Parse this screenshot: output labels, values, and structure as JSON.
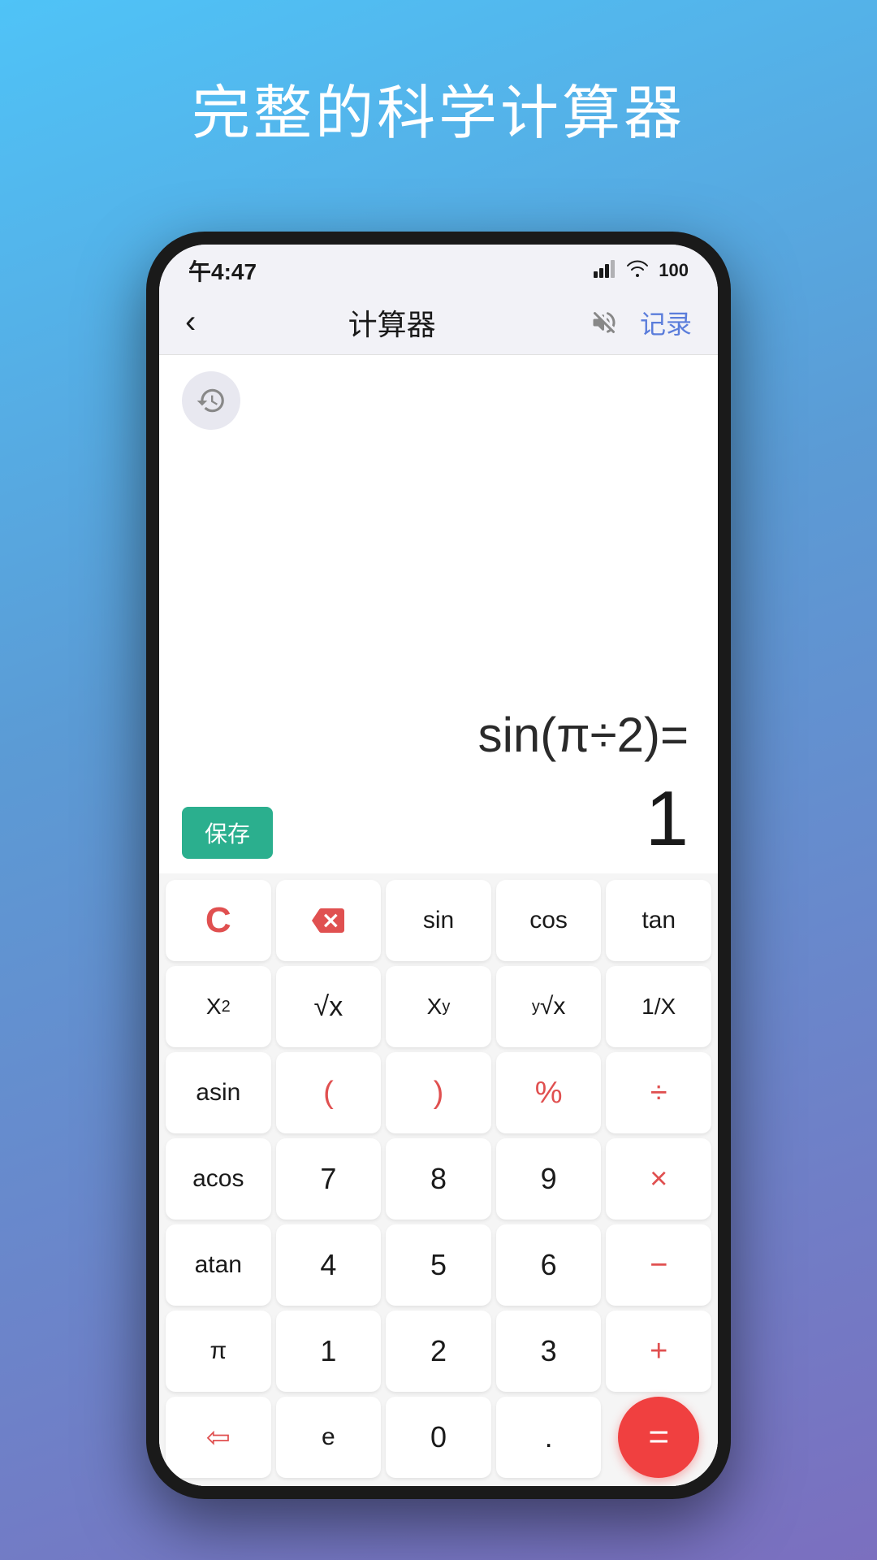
{
  "page": {
    "title": "完整的科学计算器",
    "background": "linear-gradient(160deg, #4fc3f7 0%, #5b9bd5 40%, #7b6fbf 100%)"
  },
  "status_bar": {
    "time": "午4:47",
    "signal": "▐▐▐▌",
    "wifi": "WiFi",
    "battery": "100"
  },
  "header": {
    "back_label": "‹",
    "title": "计算器",
    "record_label": "记录"
  },
  "display": {
    "formula": "sin(π÷2)=",
    "result": "1",
    "save_label": "保存"
  },
  "keypad": {
    "rows": [
      [
        {
          "label": "C",
          "type": "clear"
        },
        {
          "label": "⌫",
          "type": "delete"
        },
        {
          "label": "sin",
          "type": "func"
        },
        {
          "label": "cos",
          "type": "func"
        },
        {
          "label": "tan",
          "type": "func"
        }
      ],
      [
        {
          "label": "X²",
          "type": "math"
        },
        {
          "label": "√x",
          "type": "math"
        },
        {
          "label": "Xʸ",
          "type": "math"
        },
        {
          "label": "ʸ√x",
          "type": "math"
        },
        {
          "label": "1/X",
          "type": "math"
        }
      ],
      [
        {
          "label": "asin",
          "type": "func"
        },
        {
          "label": "(",
          "type": "operator"
        },
        {
          "label": ")",
          "type": "operator"
        },
        {
          "label": "%",
          "type": "operator"
        },
        {
          "label": "÷",
          "type": "operator"
        }
      ],
      [
        {
          "label": "acos",
          "type": "func"
        },
        {
          "label": "7",
          "type": "number"
        },
        {
          "label": "8",
          "type": "number"
        },
        {
          "label": "9",
          "type": "number"
        },
        {
          "label": "×",
          "type": "operator"
        }
      ],
      [
        {
          "label": "atan",
          "type": "func"
        },
        {
          "label": "4",
          "type": "number"
        },
        {
          "label": "5",
          "type": "number"
        },
        {
          "label": "6",
          "type": "number"
        },
        {
          "label": "−",
          "type": "operator"
        }
      ],
      [
        {
          "label": "π",
          "type": "func"
        },
        {
          "label": "1",
          "type": "number"
        },
        {
          "label": "2",
          "type": "number"
        },
        {
          "label": "3",
          "type": "number"
        },
        {
          "label": "+",
          "type": "operator"
        }
      ],
      [
        {
          "label": "⇦",
          "type": "func"
        },
        {
          "label": "e",
          "type": "func"
        },
        {
          "label": "0",
          "type": "number"
        },
        {
          "label": ".",
          "type": "number"
        },
        {
          "label": "=",
          "type": "equals"
        }
      ]
    ]
  }
}
